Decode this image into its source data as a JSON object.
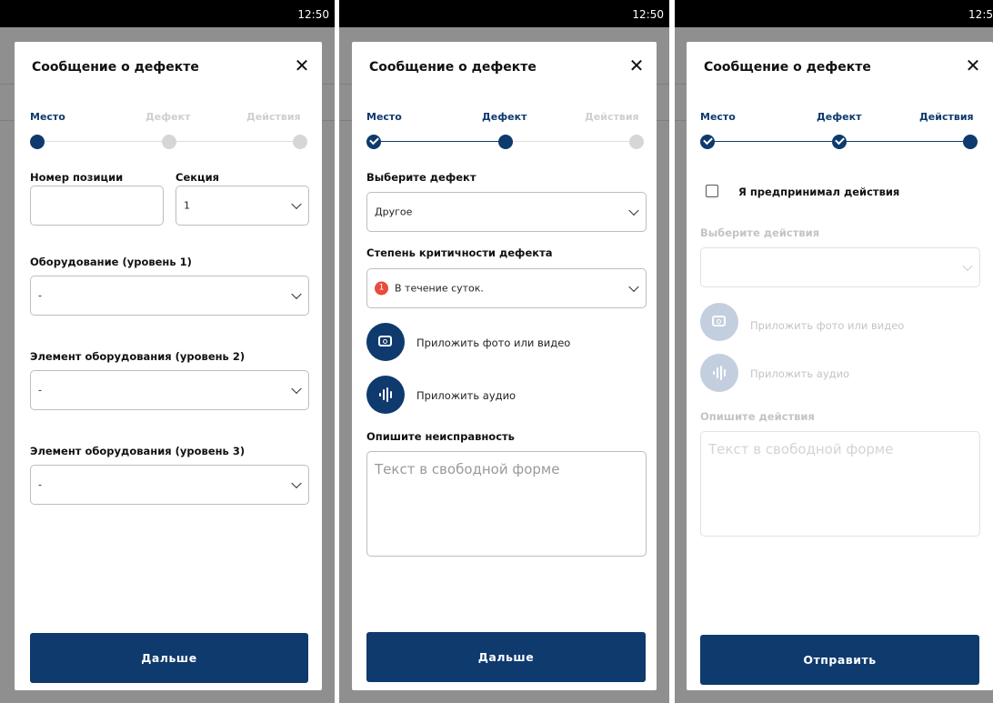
{
  "status_time": "12:50",
  "status_time_partial": "12:5",
  "dialog_title": "Сообщение о дефекте",
  "close_glyph": "✕",
  "steps": {
    "place": "Место",
    "defect": "Дефект",
    "actions": "Действия"
  },
  "screen1": {
    "position_label": "Номер позиции",
    "position_value": "",
    "section_label": "Секция",
    "section_value": "1",
    "equip1_label": "Оборудование (уровень 1)",
    "equip1_value": "-",
    "equip2_label": "Элемент оборудования (уровень 2)",
    "equip2_value": "-",
    "equip3_label": "Элемент оборудования (уровень 3)",
    "equip3_value": "-",
    "next_button": "Дальше"
  },
  "screen2": {
    "defect_label": "Выберите дефект",
    "defect_value": "Другое",
    "severity_label": "Степень критичности дефекта",
    "severity_badge": "1",
    "severity_value": "В течение суток.",
    "attach_photo": "Приложить фото или видео",
    "attach_audio": "Приложить аудио",
    "describe_label": "Опишите неисправность",
    "describe_placeholder": "Текст в свободной форме",
    "next_button": "Дальше"
  },
  "screen3": {
    "checkbox_label": "Я предпринимал действия",
    "checkbox_checked": false,
    "actions_label": "Выберите действия",
    "actions_value": "",
    "attach_photo": "Приложить фото или видео",
    "attach_audio": "Приложить аудио",
    "describe_label": "Опишите действия",
    "describe_placeholder": "Текст в свободной форме",
    "submit_button": "Отправить"
  },
  "colors": {
    "primary": "#0e3a6e",
    "inactive": "#d6d6d6",
    "badge": "#e94b3c"
  },
  "icons": [
    "close-icon",
    "checkmark-icon",
    "chevron-down-icon",
    "camera-icon",
    "audio-wave-icon",
    "checkbox-icon"
  ]
}
